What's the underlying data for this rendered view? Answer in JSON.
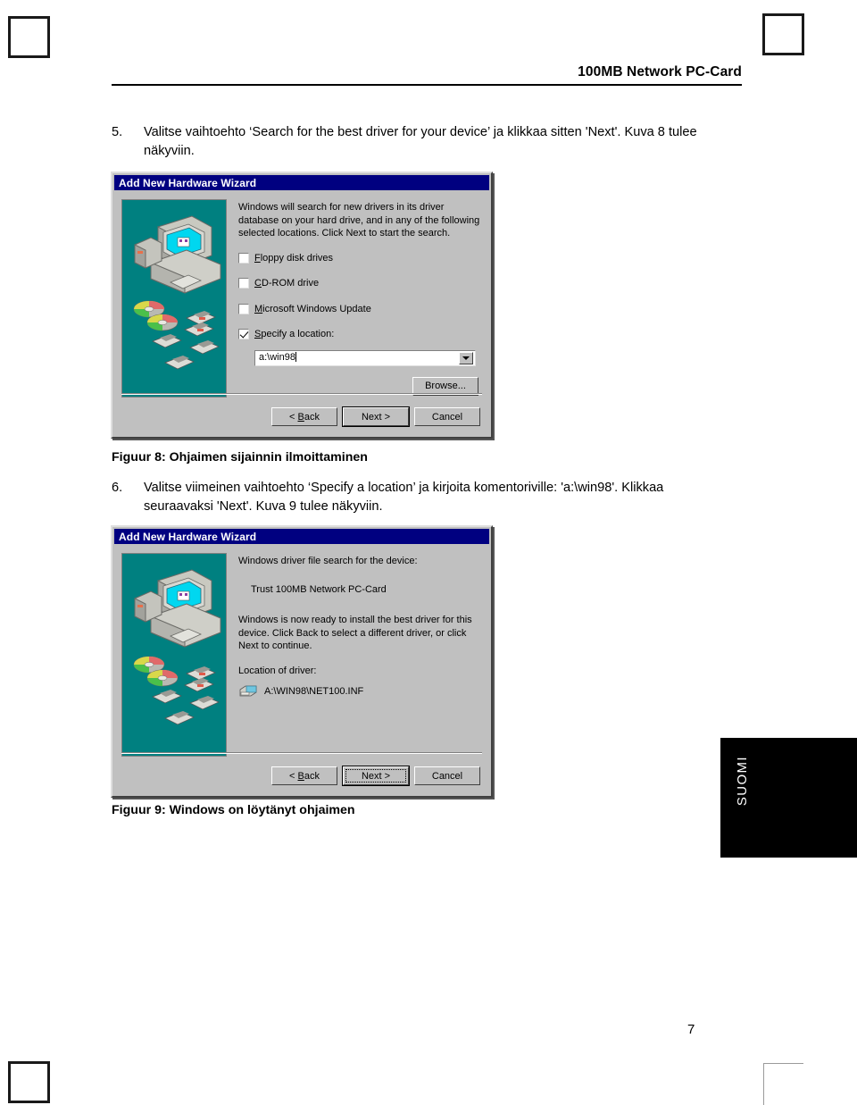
{
  "page": {
    "header_title": "100MB Network PC-Card",
    "page_number": "7",
    "side_tab_label": "SUOMI"
  },
  "steps": [
    {
      "number": "5.",
      "text": "Valitse vaihtoehto ‘Search for the best driver for your device’ ja klikkaa sitten 'Next'. Kuva 8 tulee näkyviin."
    },
    {
      "number": "6.",
      "text": "Valitse viimeinen vaihtoehto ‘Specify a location’ ja kirjoita komentoriville: 'a:\\win98'. Klikkaa seuraavaksi 'Next'. Kuva 9 tulee näkyviin."
    }
  ],
  "captions": {
    "figure_8": "Figuur 8: Ohjaimen sijainnin ilmoittaminen",
    "figure_9": "Figuur 9: Windows on löytänyt ohjaimen"
  },
  "dialog_8": {
    "title": "Add New Hardware Wizard",
    "intro": "Windows will search for new drivers in its driver database on your hard drive, and in any of the following selected locations. Click Next to start the search.",
    "checkboxes": [
      {
        "label_accel": "F",
        "label_rest": "loppy disk drives",
        "checked": false
      },
      {
        "label_accel": "C",
        "label_rest": "D-ROM drive",
        "checked": false
      },
      {
        "label_accel": "M",
        "label_rest": "icrosoft Windows Update",
        "checked": false
      },
      {
        "label_accel": "S",
        "label_rest": "pecify a location:",
        "checked": true
      }
    ],
    "location_value": "a:\\win98",
    "browse_label": "Browse...",
    "buttons": {
      "back": "< Back",
      "next": "Next >",
      "cancel": "Cancel"
    }
  },
  "dialog_9": {
    "title": "Add New Hardware Wizard",
    "search_label": "Windows driver file search for the device:",
    "device_name": "Trust 100MB Network PC-Card",
    "ready_text": "Windows is now ready to install the best driver for this device. Click Back to select a different driver, or click Next to continue.",
    "location_label": "Location of driver:",
    "driver_path": "A:\\WIN98\\NET100.INF",
    "buttons": {
      "back": "< Back",
      "next": "Next >",
      "cancel": "Cancel"
    }
  },
  "colors": {
    "titlebar": "#000080",
    "dialog_face": "#c0c0c0",
    "wizard_art_bg": "#008080",
    "monitor_screen": "#00d7f0",
    "side_tab_bg": "#000000"
  }
}
